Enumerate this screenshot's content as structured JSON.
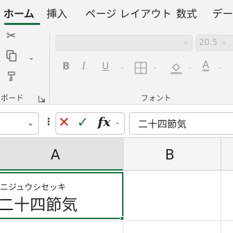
{
  "ribbon": {
    "tabs": [
      {
        "label": "ホーム",
        "active": true
      },
      {
        "label": "挿入",
        "active": false
      },
      {
        "label": "ページ レイアウト",
        "active": false
      },
      {
        "label": "数式",
        "active": false
      },
      {
        "label": "デー",
        "active": false
      }
    ],
    "clipboard": {
      "group_label": "ボード",
      "icons": [
        "scissors-icon",
        "copy-icon",
        "format-painter-icon",
        "dialog-launcher-icon"
      ]
    },
    "font": {
      "group_label": "フォント",
      "family_value": "",
      "size_value": "20.5",
      "bold": "B",
      "italic": "I",
      "underline": "U",
      "font_color_letter": "A"
    }
  },
  "formula_bar": {
    "name_box_value": "",
    "cancel_symbol": "✕",
    "enter_symbol": "✓",
    "fx_label": "fx",
    "formula": "二十四節気"
  },
  "grid": {
    "columns": [
      "A",
      "B"
    ],
    "active_cell": {
      "furigana": "ニジュウシセッキ",
      "value": "二十四節気"
    }
  },
  "colors": {
    "accent": "#1e7145",
    "cancel": "#c42b1c",
    "ribbon_bg": "#f3f3f3"
  }
}
